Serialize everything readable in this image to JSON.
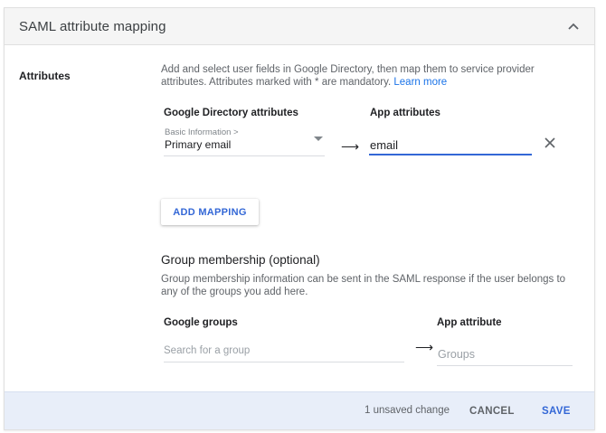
{
  "panel": {
    "title": "SAML attribute mapping"
  },
  "attributes": {
    "section_label": "Attributes",
    "description": "Add and select user fields in Google Directory, then map them to service provider attributes. Attributes marked with * are mandatory.",
    "learn_more": "Learn more",
    "google_directory_header": "Google Directory attributes",
    "app_attributes_header": "App attributes",
    "mapping": {
      "category": "Basic Information >",
      "selected": "Primary email",
      "app_value": "email"
    },
    "add_mapping_label": "ADD MAPPING"
  },
  "group_membership": {
    "title": "Group membership (optional)",
    "description": "Group membership information can be sent in the SAML response if the user belongs to any of the groups you add here.",
    "google_groups_header": "Google groups",
    "app_attribute_header": "App attribute",
    "search_placeholder": "Search for a group",
    "groups_placeholder": "Groups"
  },
  "footer": {
    "unsaved": "1 unsaved change",
    "cancel_label": "CANCEL",
    "save_label": "SAVE"
  },
  "icons": {
    "collapse": "chevron-up-icon",
    "dropdown": "caret-down-icon",
    "arrow": "arrow-right-icon",
    "remove": "close-icon"
  },
  "colors": {
    "accent": "#3367d6",
    "link": "#1a73e8",
    "header_bg": "#f5f5f5",
    "footer_bg": "#e8eef9"
  }
}
